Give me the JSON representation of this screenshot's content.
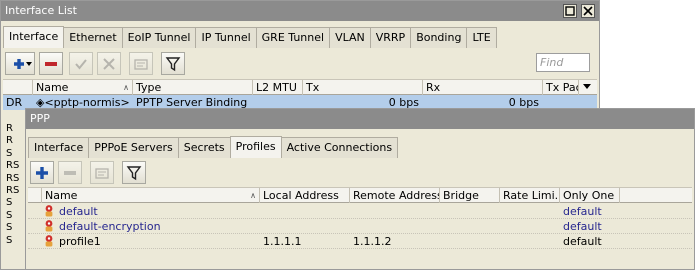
{
  "interface_list": {
    "title": "Interface List",
    "tabs": [
      "Interface",
      "Ethernet",
      "EoIP Tunnel",
      "IP Tunnel",
      "GRE Tunnel",
      "VLAN",
      "VRRP",
      "Bonding",
      "LTE"
    ],
    "active_tab": "Interface",
    "find_placeholder": "Find",
    "columns": [
      "",
      "Name",
      "Type",
      "L2 MTU",
      "Tx",
      "Rx",
      "Tx Pac"
    ],
    "selected_row": {
      "flag": "DR",
      "name": "<pptp-normis>",
      "name_prefix": "◈",
      "type": "PPTP Server Binding",
      "l2mtu": "",
      "tx": "0 bps",
      "rx": "0 bps"
    },
    "flags_visible": [
      "R",
      "R",
      "S",
      "RS",
      "RS",
      "RS",
      "S",
      "S",
      "S",
      "S"
    ]
  },
  "ppp": {
    "title": "PPP",
    "tabs": [
      "Interface",
      "PPPoE Servers",
      "Secrets",
      "Profiles",
      "Active Connections"
    ],
    "active_tab": "Profiles",
    "columns": [
      "Name",
      "Local Address",
      "Remote Address",
      "Bridge",
      "Rate Limi...",
      "Only One"
    ],
    "rows": [
      {
        "name": "default",
        "local": "",
        "remote": "",
        "bridge": "",
        "rate": "",
        "only_one": "default",
        "is_default": true
      },
      {
        "name": "default-encryption",
        "local": "",
        "remote": "",
        "bridge": "",
        "rate": "",
        "only_one": "default",
        "is_default": true
      },
      {
        "name": "profile1",
        "local": "1.1.1.1",
        "remote": "1.1.1.2",
        "bridge": "",
        "rate": "",
        "only_one": "default",
        "is_default": false
      }
    ]
  },
  "colors": {
    "titlebar": "#8b8b8b",
    "selection": "#b3cdea",
    "add": "#1b4fa8",
    "remove": "#c0272d",
    "link_text": "#27278f"
  }
}
